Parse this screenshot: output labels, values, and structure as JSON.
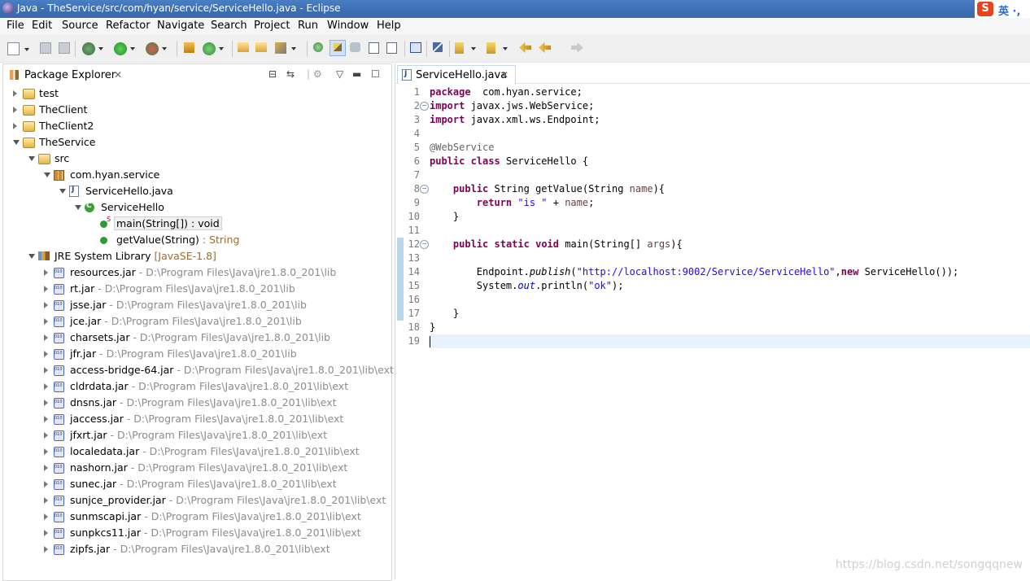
{
  "window": {
    "title": "Java - TheService/src/com/hyan/service/ServiceHello.java - Eclipse"
  },
  "ime": {
    "logo": "S",
    "text": "英 ·,"
  },
  "menu": [
    "File",
    "Edit",
    "Source",
    "Refactor",
    "Navigate",
    "Search",
    "Project",
    "Run",
    "Window",
    "Help"
  ],
  "package_explorer": {
    "tab_label": "Package Explorer",
    "close": "✕",
    "tree": [
      {
        "label": "test",
        "icon": "folder-icon",
        "indent": 0,
        "arrow": "right"
      },
      {
        "label": "TheClient",
        "icon": "folder-icon",
        "indent": 0,
        "arrow": "right"
      },
      {
        "label": "TheClient2",
        "icon": "folder-icon",
        "indent": 0,
        "arrow": "right"
      },
      {
        "label": "TheService",
        "icon": "folder-icon",
        "indent": 0,
        "arrow": "down"
      },
      {
        "label": "src",
        "icon": "source-folder-icon",
        "indent": 1,
        "arrow": "down"
      },
      {
        "label": "com.hyan.service",
        "icon": "package-icon",
        "indent": 2,
        "arrow": "down"
      },
      {
        "label": "ServiceHello.java",
        "icon": "java-file-icon",
        "indent": 3,
        "arrow": "down"
      },
      {
        "label": "ServiceHello",
        "icon": "class-icon",
        "indent": 4,
        "arrow": "down"
      },
      {
        "label": "main(String[]) : void",
        "icon": "static-method-icon",
        "indent": 5,
        "arrow": "none",
        "selected": true,
        "static_mark": "S"
      },
      {
        "label": "getValue(String)",
        "suffix": " : String",
        "icon": "method-icon",
        "indent": 5,
        "arrow": "none"
      },
      {
        "label": "JRE System Library",
        "suffix": " [JavaSE-1.8]",
        "icon": "library-icon",
        "indent": 1,
        "arrow": "down"
      },
      {
        "label": "resources.jar",
        "path": " - D:\\Program Files\\Java\\jre1.8.0_201\\lib",
        "icon": "jar-icon",
        "indent": 2,
        "arrow": "right"
      },
      {
        "label": "rt.jar",
        "path": " - D:\\Program Files\\Java\\jre1.8.0_201\\lib",
        "icon": "jar-icon",
        "indent": 2,
        "arrow": "right"
      },
      {
        "label": "jsse.jar",
        "path": " - D:\\Program Files\\Java\\jre1.8.0_201\\lib",
        "icon": "jar-icon",
        "indent": 2,
        "arrow": "right"
      },
      {
        "label": "jce.jar",
        "path": " - D:\\Program Files\\Java\\jre1.8.0_201\\lib",
        "icon": "jar-icon",
        "indent": 2,
        "arrow": "right"
      },
      {
        "label": "charsets.jar",
        "path": " - D:\\Program Files\\Java\\jre1.8.0_201\\lib",
        "icon": "jar-icon",
        "indent": 2,
        "arrow": "right"
      },
      {
        "label": "jfr.jar",
        "path": " - D:\\Program Files\\Java\\jre1.8.0_201\\lib",
        "icon": "jar-icon",
        "indent": 2,
        "arrow": "right"
      },
      {
        "label": "access-bridge-64.jar",
        "path": " - D:\\Program Files\\Java\\jre1.8.0_201\\lib\\ext",
        "icon": "jar-icon",
        "indent": 2,
        "arrow": "right"
      },
      {
        "label": "cldrdata.jar",
        "path": " - D:\\Program Files\\Java\\jre1.8.0_201\\lib\\ext",
        "icon": "jar-icon",
        "indent": 2,
        "arrow": "right"
      },
      {
        "label": "dnsns.jar",
        "path": " - D:\\Program Files\\Java\\jre1.8.0_201\\lib\\ext",
        "icon": "jar-icon",
        "indent": 2,
        "arrow": "right"
      },
      {
        "label": "jaccess.jar",
        "path": " - D:\\Program Files\\Java\\jre1.8.0_201\\lib\\ext",
        "icon": "jar-icon",
        "indent": 2,
        "arrow": "right"
      },
      {
        "label": "jfxrt.jar",
        "path": " - D:\\Program Files\\Java\\jre1.8.0_201\\lib\\ext",
        "icon": "jar-icon",
        "indent": 2,
        "arrow": "right"
      },
      {
        "label": "localedata.jar",
        "path": " - D:\\Program Files\\Java\\jre1.8.0_201\\lib\\ext",
        "icon": "jar-icon",
        "indent": 2,
        "arrow": "right"
      },
      {
        "label": "nashorn.jar",
        "path": " - D:\\Program Files\\Java\\jre1.8.0_201\\lib\\ext",
        "icon": "jar-icon",
        "indent": 2,
        "arrow": "right"
      },
      {
        "label": "sunec.jar",
        "path": " - D:\\Program Files\\Java\\jre1.8.0_201\\lib\\ext",
        "icon": "jar-icon",
        "indent": 2,
        "arrow": "right"
      },
      {
        "label": "sunjce_provider.jar",
        "path": " - D:\\Program Files\\Java\\jre1.8.0_201\\lib\\ext",
        "icon": "jar-icon",
        "indent": 2,
        "arrow": "right"
      },
      {
        "label": "sunmscapi.jar",
        "path": " - D:\\Program Files\\Java\\jre1.8.0_201\\lib\\ext",
        "icon": "jar-icon",
        "indent": 2,
        "arrow": "right"
      },
      {
        "label": "sunpkcs11.jar",
        "path": " - D:\\Program Files\\Java\\jre1.8.0_201\\lib\\ext",
        "icon": "jar-icon",
        "indent": 2,
        "arrow": "right"
      },
      {
        "label": "zipfs.jar",
        "path": " - D:\\Program Files\\Java\\jre1.8.0_201\\lib\\ext",
        "icon": "jar-icon",
        "indent": 2,
        "arrow": "right"
      }
    ]
  },
  "editor": {
    "tab_label": "ServiceHello.java",
    "close": "✕",
    "folding_lines": [
      2,
      8,
      12
    ],
    "current_line": 19,
    "lines": [
      [
        [
          "kw",
          "package"
        ],
        [
          "",
          "  com.hyan.service;"
        ]
      ],
      [
        [
          "kw",
          "import"
        ],
        [
          "",
          " javax.jws.WebService;"
        ]
      ],
      [
        [
          "kw",
          "import"
        ],
        [
          "",
          " javax.xml.ws.Endpoint;"
        ]
      ],
      [],
      [
        [
          "ann",
          "@WebService"
        ]
      ],
      [
        [
          "kw",
          "public"
        ],
        [
          "",
          " "
        ],
        [
          "kw",
          "class"
        ],
        [
          "",
          " ServiceHello {"
        ]
      ],
      [],
      [
        [
          "",
          "    "
        ],
        [
          "kw",
          "public"
        ],
        [
          "",
          " String getValue(String "
        ],
        [
          "param",
          "name"
        ],
        [
          "",
          "){"
        ]
      ],
      [
        [
          "",
          "        "
        ],
        [
          "kw",
          "return"
        ],
        [
          "",
          " "
        ],
        [
          "str",
          "\"is \""
        ],
        [
          "",
          " + "
        ],
        [
          "param",
          "name"
        ],
        [
          "",
          ";"
        ]
      ],
      [
        [
          "",
          "    }"
        ]
      ],
      [],
      [
        [
          "",
          "    "
        ],
        [
          "kw",
          "public"
        ],
        [
          "",
          " "
        ],
        [
          "kw",
          "static"
        ],
        [
          "",
          " "
        ],
        [
          "kw",
          "void"
        ],
        [
          "",
          " main(String[] "
        ],
        [
          "param",
          "args"
        ],
        [
          "",
          "){"
        ]
      ],
      [],
      [
        [
          "",
          "        Endpoint."
        ],
        [
          "it",
          "publish"
        ],
        [
          "",
          "("
        ],
        [
          "str",
          "\"http://localhost:9002/Service/ServiceHello\""
        ],
        [
          "",
          ","
        ],
        [
          "kw",
          "new"
        ],
        [
          "",
          " ServiceHello());"
        ]
      ],
      [
        [
          "",
          "        System."
        ],
        [
          "fld",
          "out"
        ],
        [
          "",
          ".println("
        ],
        [
          "str",
          "\"ok\""
        ],
        [
          "",
          ");"
        ]
      ],
      [],
      [
        [
          "",
          "    }"
        ]
      ],
      [
        [
          "",
          "}"
        ]
      ],
      []
    ]
  },
  "watermark": "https://blog.csdn.net/songqqnew"
}
